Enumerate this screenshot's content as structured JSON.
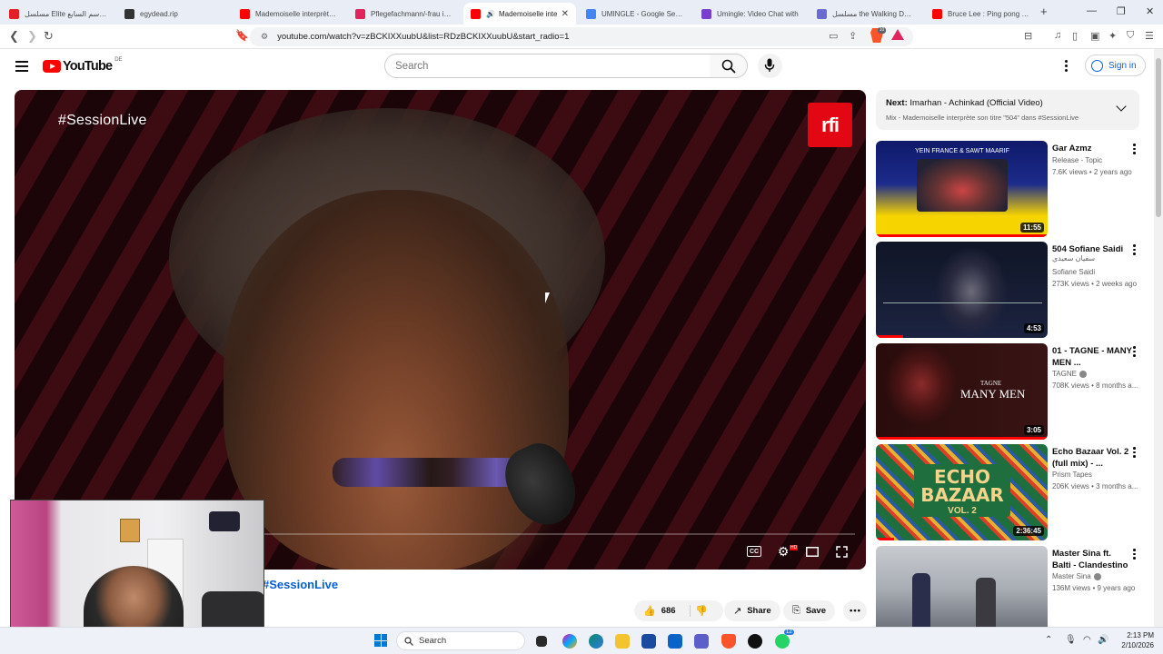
{
  "browser": {
    "tabs": [
      {
        "label": "مسلسل Elite الموسم السابع",
        "favicon_color": "#e41e26"
      },
      {
        "label": "egydead.rip",
        "favicon_color": "#333333"
      },
      {
        "label": "Mademoiselle interprète s",
        "favicon_color": "#ff0000"
      },
      {
        "label": "Pflegefachmann/-frau in 3",
        "favicon_color": "#e0245e"
      },
      {
        "label": "Mademoiselle inte",
        "favicon_color": "#ff0000",
        "active": true
      },
      {
        "label": "UMINGLE - Google Search",
        "favicon_color": "#4285f4"
      },
      {
        "label": "Umingle: Video Chat with",
        "favicon_color": "#7a3fd1"
      },
      {
        "label": "مسلسل the Walking Dead",
        "favicon_color": "#6b6bd6"
      },
      {
        "label": "Bruce Lee : Ping pong wit",
        "favicon_color": "#ff0000"
      }
    ],
    "new_tab": "+",
    "url": "youtube.com/watch?v=zBCKIXXuubU&list=RDzBCKIXXuubU&start_radio=1",
    "brave_badge": "10"
  },
  "youtube": {
    "logo_text": "YouTube",
    "region": "DE",
    "search_placeholder": "Search",
    "sign_in": "Sign in",
    "player": {
      "overlay_text": "#SessionLive",
      "channel_logo": "rfi",
      "hd_badge": "HD",
      "cc_label": "CC"
    },
    "video_title_visible": "#SessionLive",
    "actions": {
      "likes": "686",
      "share": "Share",
      "save": "Save"
    },
    "next_up": {
      "prefix": "Next:",
      "title": "Imarhan - Achinkad (Official Video)",
      "subtitle": "Mix - Mademoiselle interprète son titre \"504\" dans #SessionLive"
    },
    "recommendations": [
      {
        "title": "Gar Azmz",
        "channel": "Release - Topic",
        "meta": "7.6K views • 2 years ago",
        "duration": "11:55",
        "thumb_color": "#1d2b8a",
        "verified": false
      },
      {
        "title": "504 Sofiane Saidi",
        "subtitle_ar": "سفيان سعيدي",
        "channel": "Sofiane Saidi",
        "meta": "273K views • 2 weeks ago",
        "duration": "4:53",
        "thumb_color": "#141a2a",
        "verified": false
      },
      {
        "title": "01 - TAGNE - MANY MEN ...",
        "channel": "TAGNE",
        "meta": "708K views • 8 months a...",
        "duration": "3:05",
        "thumb_color": "#3a1414",
        "verified": true
      },
      {
        "title": "Echo Bazaar Vol. 2 (full mix) - ...",
        "channel": "Prism Tapes",
        "meta": "206K views • 3 months a...",
        "duration": "2:36:45",
        "thumb_color": "#1e6e3e",
        "verified": false
      },
      {
        "title": "Master Sina ft. Balti - Clandestino",
        "channel": "Master Sina",
        "meta": "136M views • 9 years ago",
        "duration": "",
        "thumb_color": "#7a7e86",
        "verified": true
      }
    ]
  },
  "taskbar": {
    "search": "Search",
    "time": "2:13 PM",
    "date": "2/10/2026",
    "whatsapp_badge": "12"
  }
}
